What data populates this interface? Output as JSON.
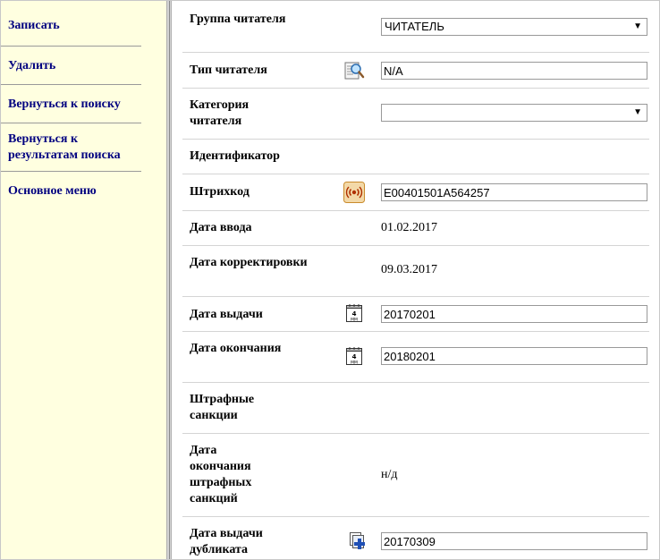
{
  "sidebar": {
    "items": [
      {
        "label": "Записать"
      },
      {
        "label": "Удалить"
      },
      {
        "label": "Вернуться к поиску"
      },
      {
        "label": "Вернуться к результатам поиска"
      },
      {
        "label": "Основное меню"
      }
    ]
  },
  "form": {
    "reader_group": {
      "label": "Группа читателя",
      "value": "ЧИТАТЕЛЬ"
    },
    "reader_type": {
      "label": "Тип читателя",
      "value": "N/A",
      "icon": "search-dictionary-icon"
    },
    "reader_category": {
      "label": "Категория читателя",
      "value": ""
    },
    "identifier": {
      "label": "Идентификатор"
    },
    "barcode": {
      "label": "Штрихкод",
      "value": "E00401501A564257",
      "icon": "rfid-icon"
    },
    "entry_date": {
      "label": "Дата ввода",
      "value": "01.02.2017"
    },
    "modified_date": {
      "label": "Дата корректировки",
      "value": "09.03.2017"
    },
    "issue_date": {
      "label": "Дата выдачи",
      "value": "20170201",
      "icon": "calendar-icon",
      "icon_day": "4",
      "icon_month": "MM"
    },
    "expiry_date": {
      "label": "Дата окончания",
      "value": "20180201",
      "icon": "calendar-icon",
      "icon_day": "4",
      "icon_month": "MM"
    },
    "penalties": {
      "label": "Штрафные санкции"
    },
    "penalty_end_date": {
      "label": "Дата окончания штрафных санкций",
      "value": "н/д"
    },
    "duplicate_issue_date": {
      "label": "Дата выдачи дубликата",
      "value": "20170309",
      "icon": "duplicate-plus-icon"
    }
  },
  "colors": {
    "sidebar_bg": "#ffffe0",
    "link": "#000080"
  }
}
